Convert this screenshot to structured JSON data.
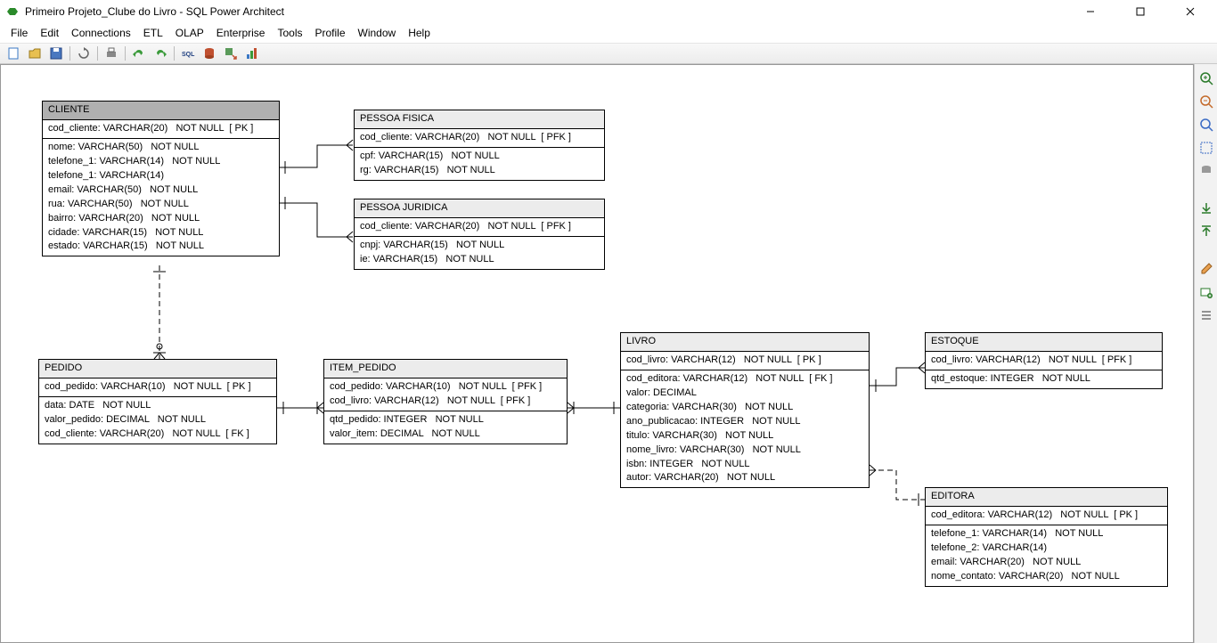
{
  "window": {
    "title": "Primeiro Projeto_Clube do Livro - SQL Power Architect"
  },
  "menu": {
    "file": "File",
    "edit": "Edit",
    "connections": "Connections",
    "etl": "ETL",
    "olap": "OLAP",
    "enterprise": "Enterprise",
    "tools": "Tools",
    "profile": "Profile",
    "window": "Window",
    "help": "Help"
  },
  "toolbar_icons": [
    "new-icon",
    "open-icon",
    "save-icon",
    "refresh-icon",
    "print-icon",
    "undo-icon",
    "redo-icon",
    "sql-icon",
    "db-icon",
    "export-icon",
    "chart-icon"
  ],
  "side_icons": [
    "zoom-in-icon",
    "zoom-out-icon",
    "zoom-fit-icon",
    "zoom-select-icon",
    "db-tree-icon",
    "download-icon",
    "upload-icon",
    "edit-icon",
    "new-table-icon",
    "new-relation-icon"
  ],
  "entities": {
    "cliente": {
      "name": "CLIENTE",
      "pk": [
        "cod_cliente: VARCHAR(20)   NOT NULL  [ PK ]"
      ],
      "cols": [
        "nome: VARCHAR(50)   NOT NULL",
        "telefone_1: VARCHAR(14)   NOT NULL",
        "telefone_1: VARCHAR(14)",
        "email: VARCHAR(50)   NOT NULL",
        "rua: VARCHAR(50)   NOT NULL",
        "bairro: VARCHAR(20)   NOT NULL",
        "cidade: VARCHAR(15)   NOT NULL",
        "estado: VARCHAR(15)   NOT NULL"
      ]
    },
    "pessoa_fisica": {
      "name": "PESSOA FISICA",
      "pk": [
        "cod_cliente: VARCHAR(20)   NOT NULL  [ PFK ]"
      ],
      "cols": [
        "cpf: VARCHAR(15)   NOT NULL",
        "rg: VARCHAR(15)   NOT NULL"
      ]
    },
    "pessoa_juridica": {
      "name": "PESSOA JURIDICA",
      "pk": [
        "cod_cliente: VARCHAR(20)   NOT NULL  [ PFK ]"
      ],
      "cols": [
        "cnpj: VARCHAR(15)   NOT NULL",
        "ie: VARCHAR(15)   NOT NULL"
      ]
    },
    "pedido": {
      "name": "PEDIDO",
      "pk": [
        "cod_pedido: VARCHAR(10)   NOT NULL  [ PK ]"
      ],
      "cols": [
        "data: DATE   NOT NULL",
        "valor_pedido: DECIMAL   NOT NULL",
        "cod_cliente: VARCHAR(20)   NOT NULL  [ FK ]"
      ]
    },
    "item_pedido": {
      "name": "ITEM_PEDIDO",
      "pk": [
        "cod_pedido: VARCHAR(10)   NOT NULL  [ PFK ]",
        "cod_livro: VARCHAR(12)   NOT NULL  [ PFK ]"
      ],
      "cols": [
        "qtd_pedido: INTEGER   NOT NULL",
        "valor_item: DECIMAL   NOT NULL"
      ]
    },
    "livro": {
      "name": "LIVRO",
      "pk": [
        "cod_livro: VARCHAR(12)   NOT NULL  [ PK ]"
      ],
      "cols": [
        "cod_editora: VARCHAR(12)   NOT NULL  [ FK ]",
        "valor: DECIMAL",
        "categoria: VARCHAR(30)   NOT NULL",
        "ano_publicacao: INTEGER   NOT NULL",
        "titulo: VARCHAR(30)   NOT NULL",
        "nome_livro: VARCHAR(30)   NOT NULL",
        "isbn: INTEGER   NOT NULL",
        "autor: VARCHAR(20)   NOT NULL"
      ]
    },
    "estoque": {
      "name": "ESTOQUE",
      "pk": [
        "cod_livro: VARCHAR(12)   NOT NULL  [ PFK ]"
      ],
      "cols": [
        "qtd_estoque: INTEGER   NOT NULL"
      ]
    },
    "editora": {
      "name": "EDITORA",
      "pk": [
        "cod_editora: VARCHAR(12)   NOT NULL  [ PK ]"
      ],
      "cols": [
        "telefone_1: VARCHAR(14)   NOT NULL",
        "telefone_2: VARCHAR(14)",
        "email: VARCHAR(20)   NOT NULL",
        "nome_contato: VARCHAR(20)   NOT NULL"
      ]
    }
  }
}
